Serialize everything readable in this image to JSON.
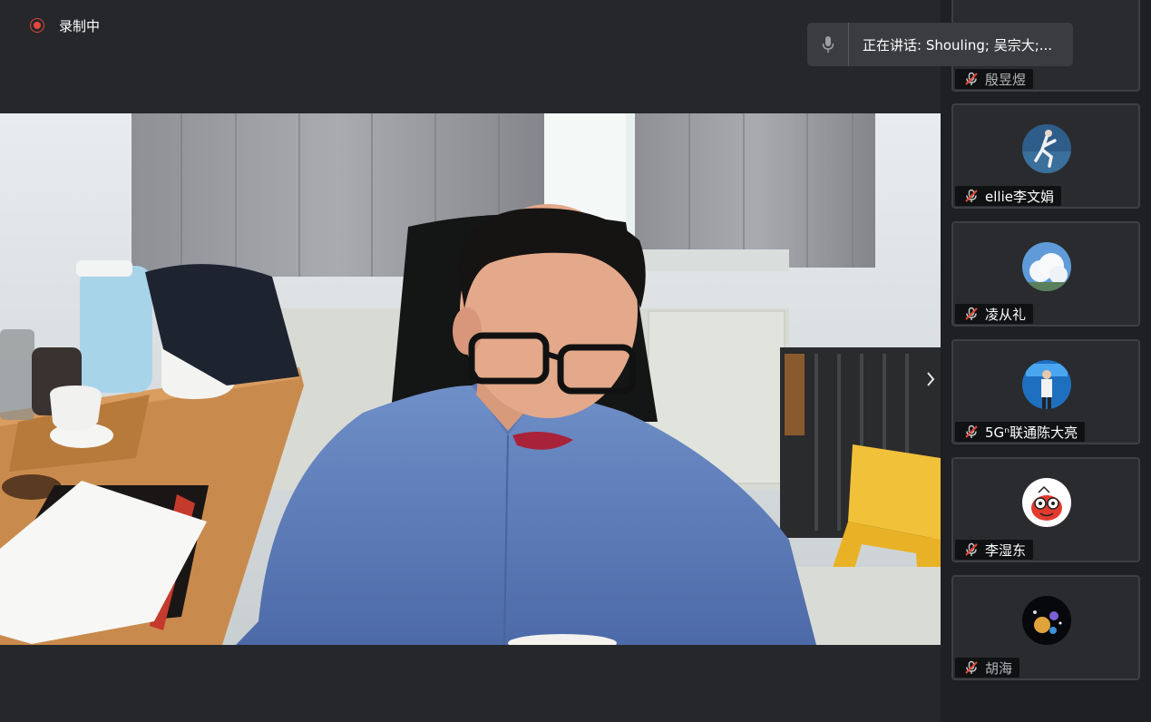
{
  "recording": {
    "label": "录制中"
  },
  "speaking": {
    "label": "正在讲话: Shouling; 吴宗大;..."
  },
  "participants": [
    {
      "name": "殷昱煜",
      "muted": true,
      "avatar": "none"
    },
    {
      "name": "ellie李文娟",
      "muted": true,
      "avatar": "athlete-photo"
    },
    {
      "name": "凌从礼",
      "muted": true,
      "avatar": "sky-cloud-photo"
    },
    {
      "name": "5Gⁿ联通陈大亮",
      "muted": true,
      "avatar": "stage-speaker-photo"
    },
    {
      "name": "李湿东",
      "muted": true,
      "avatar": "cartoon-character"
    },
    {
      "name": "胡海",
      "muted": true,
      "avatar": "space-planets"
    }
  ],
  "colors": {
    "background": "#26272a",
    "sidebar": "#1f2023",
    "recording_red": "#e5483b",
    "mute_red": "#e5483b",
    "tile_border": "#3e3f43"
  }
}
